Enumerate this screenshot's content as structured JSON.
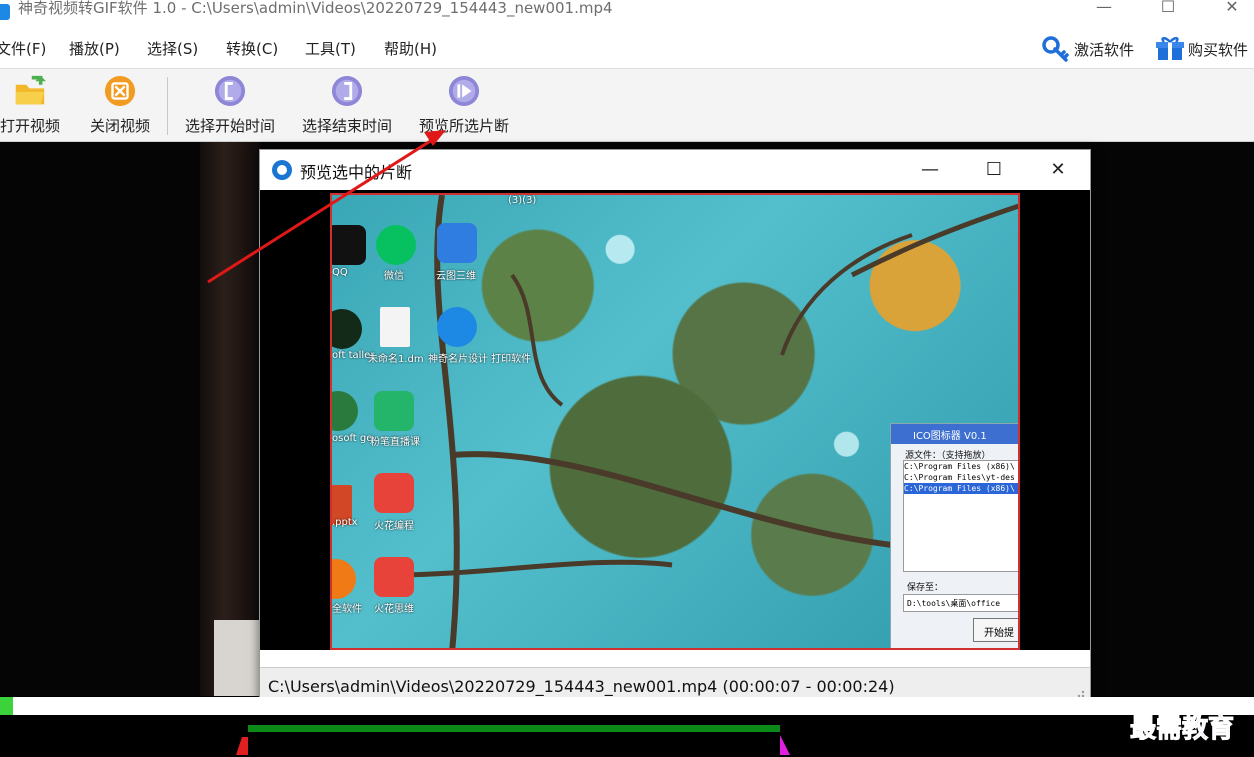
{
  "window": {
    "title": "神奇视频转GIF软件 1.0 - C:\\Users\\admin\\Videos\\20220729_154443_new001.mp4",
    "controls": [
      "—",
      "☐",
      "✕"
    ]
  },
  "menu": {
    "items": [
      "文件(F)",
      "播放(P)",
      "选择(S)",
      "转换(C)",
      "工具(T)",
      "帮助(H)"
    ],
    "activate": "激活软件",
    "buy": "购买软件"
  },
  "toolbar": {
    "open": "打开视频",
    "close": "关闭视频",
    "select_start": "选择开始时间",
    "select_end": "选择结束时间",
    "preview": "预览所选片断"
  },
  "popup": {
    "title": "预览选中的片断",
    "status": "C:\\Users\\admin\\Videos\\20220729_154443_new001.mp4 (00:00:07 - 00:00:24)"
  },
  "desktop": {
    "icons": [
      "QQ",
      "微信",
      "云图三维",
      "oft\ntaller",
      "未命名1.dm",
      "神奇名片设计\n打印软件",
      "osoft\nge",
      "粉笔直播课",
      ".pptx",
      "火花编程",
      "全软件",
      "火花思维"
    ],
    "top_label": "(3)(3)"
  },
  "subwindow": {
    "title": "ICO图标器 V0.1",
    "source_label": "源文件：（支持拖放）",
    "files": [
      "C:\\Program Files (x86)\\",
      "C:\\Program Files\\yt-des",
      "C:\\Program Files (x86)\\"
    ],
    "save_label": "保存至：",
    "save_path": "D:\\tools\\桌面\\office",
    "start_button": "开始提"
  },
  "watermark": "最需教育",
  "colors": {
    "accent": "#1976d2",
    "selection_bar": "#0c8a17",
    "start_marker": "#e02020",
    "end_marker": "#e020e0",
    "progress": "#3bd23b",
    "arrow": "#e01818"
  },
  "playback_progress": 0.01
}
